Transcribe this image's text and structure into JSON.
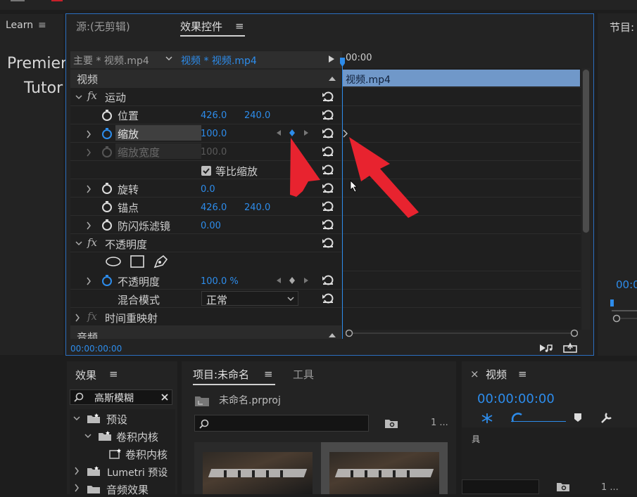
{
  "learn": {
    "tab": "Learn",
    "menu": "≡",
    "line1": "Premier",
    "line2": "Tutor"
  },
  "effect_controls": {
    "tab_source": "源:(无剪辑)",
    "tab_effects": "效果控件",
    "tab_menu": "≡",
    "clip_master": "主要 * 视频.mp4",
    "clip_current": "视频 * 视频.mp4",
    "ruler_time": "00:00",
    "clip_block": "视频.mp4",
    "rows": {
      "video": "视频",
      "motion": "运动",
      "position": "位置",
      "position_x": "426.0",
      "position_y": "240.0",
      "scale": "缩放",
      "scale_val": "100.0",
      "scale_width": "缩放宽度",
      "scale_width_val": "100.0",
      "uniform_scale": "等比缩放",
      "rotation": "旋转",
      "rotation_val": "0.0",
      "anchor": "锚点",
      "anchor_x": "426.0",
      "anchor_y": "240.0",
      "anti_flicker": "防闪烁滤镜",
      "anti_flicker_val": "0.00",
      "opacity_group": "不透明度",
      "opacity": "不透明度",
      "opacity_val": "100.0 %",
      "blend": "混合模式",
      "blend_val": "正常",
      "time_remap": "时间重映射",
      "audio": "音频"
    },
    "bottom_time": "00:00:00:00"
  },
  "program": {
    "title": "节目:",
    "time": "00:0"
  },
  "effects_panel": {
    "title": "效果",
    "menu": "≡",
    "search_value": "高斯模糊",
    "tree": {
      "presets": "预设",
      "convolution": "卷积内核",
      "convolution_item": "卷积内核",
      "lumetri": "Lumetri 预设",
      "audio_effects": "音频效果"
    }
  },
  "project_panel": {
    "tab_project": "项目:未命名",
    "menu": "≡",
    "tab_tools": "工具",
    "file": "未命名.prproj",
    "count": "1 ..."
  },
  "timeline_panel": {
    "close": "×",
    "title": "视频",
    "menu": "≡",
    "time": "00:00:00:00",
    "track_label": "具",
    "count": "1 ..."
  },
  "colors": {
    "accent": "#2d8ceb",
    "panel_border": "#2b6fc0",
    "clip_block": "#7098c9",
    "annotation_arrow": "#e8232f"
  }
}
